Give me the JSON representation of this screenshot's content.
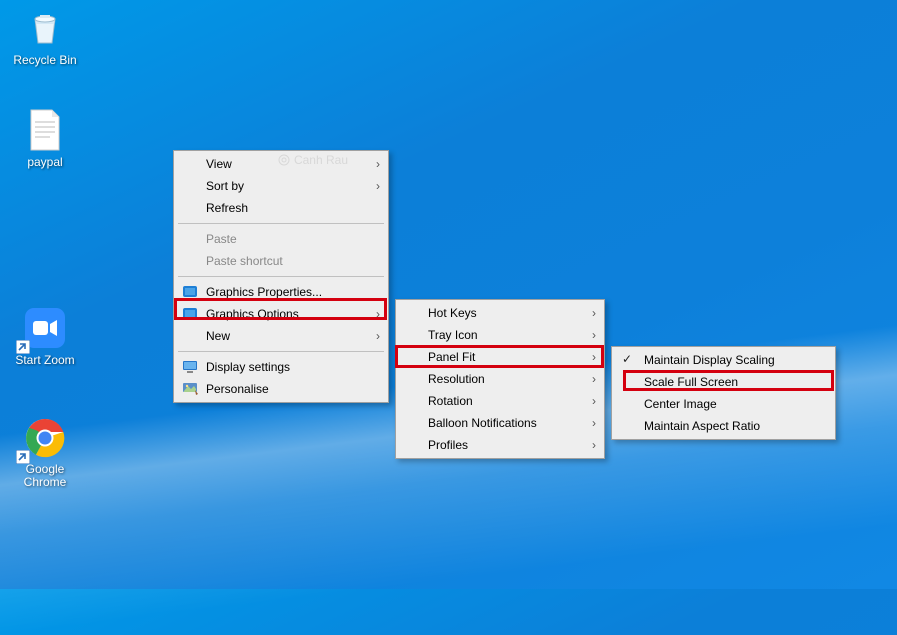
{
  "desktop": {
    "icons": [
      {
        "label": "Recycle Bin"
      },
      {
        "label": "paypal"
      },
      {
        "label": "Start Zoom"
      },
      {
        "label": "Google Chrome"
      }
    ]
  },
  "watermark": "Canh Rau",
  "menu1": {
    "view": "View",
    "sortby": "Sort by",
    "refresh": "Refresh",
    "paste": "Paste",
    "paste_shortcut": "Paste shortcut",
    "graphics_properties": "Graphics Properties...",
    "graphics_options": "Graphics Options",
    "new": "New",
    "display_settings": "Display settings",
    "personalise": "Personalise"
  },
  "menu2": {
    "hotkeys": "Hot Keys",
    "trayicon": "Tray Icon",
    "panelfit": "Panel Fit",
    "resolution": "Resolution",
    "rotation": "Rotation",
    "balloon": "Balloon Notifications",
    "profiles": "Profiles"
  },
  "menu3": {
    "maintain_scaling": "Maintain Display Scaling",
    "scale_full": "Scale Full Screen",
    "center_image": "Center Image",
    "aspect_ratio": "Maintain Aspect Ratio"
  }
}
